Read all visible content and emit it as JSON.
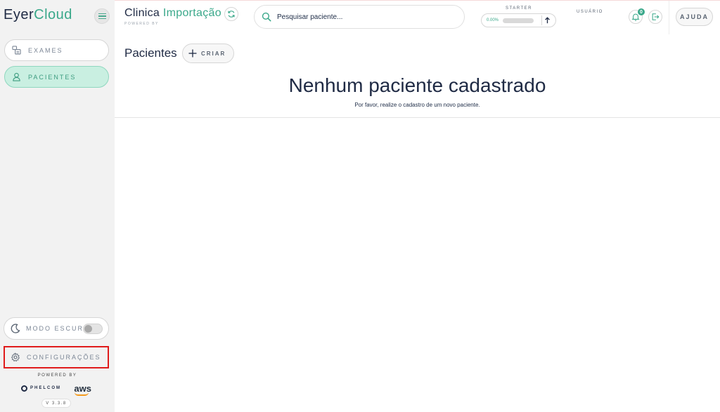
{
  "sidebar": {
    "brand_main": "Eyer",
    "brand_accent": "Cloud",
    "items": [
      {
        "label": "EXAMES",
        "icon": "exam-icon"
      },
      {
        "label": "PACIENTES",
        "icon": "patient-icon",
        "active": true
      }
    ],
    "dark_mode_label": "MODO ESCURO",
    "dark_mode_enabled": false,
    "settings_label": "CONFIGURAÇÕES",
    "powered_by": "POWERED BY",
    "partner_logos": [
      "PHELCOM",
      "aws"
    ],
    "version": "V 3.3.8"
  },
  "header": {
    "clinic_main": "Clinica ",
    "clinic_accent": "Importação",
    "clinic_powered": "POWERED BY",
    "search_placeholder": "Pesquisar paciente...",
    "plan_label": "STARTER",
    "plan_usage": "0.00%",
    "plan_usage_fraction": 0.0,
    "user_label": "USUÁRIO",
    "notification_count": "0",
    "help_label": "AJUDA"
  },
  "main": {
    "title": "Pacientes",
    "create_label": "CRIAR",
    "empty_title": "Nenhum paciente cadastrado",
    "empty_subtitle": "Por favor, realize o cadastro de um novo paciente."
  },
  "colors": {
    "accent": "#3aa88a",
    "active_bg": "#c9efe1",
    "text_dark": "#1f2a44",
    "highlight": "#e01b1b"
  }
}
